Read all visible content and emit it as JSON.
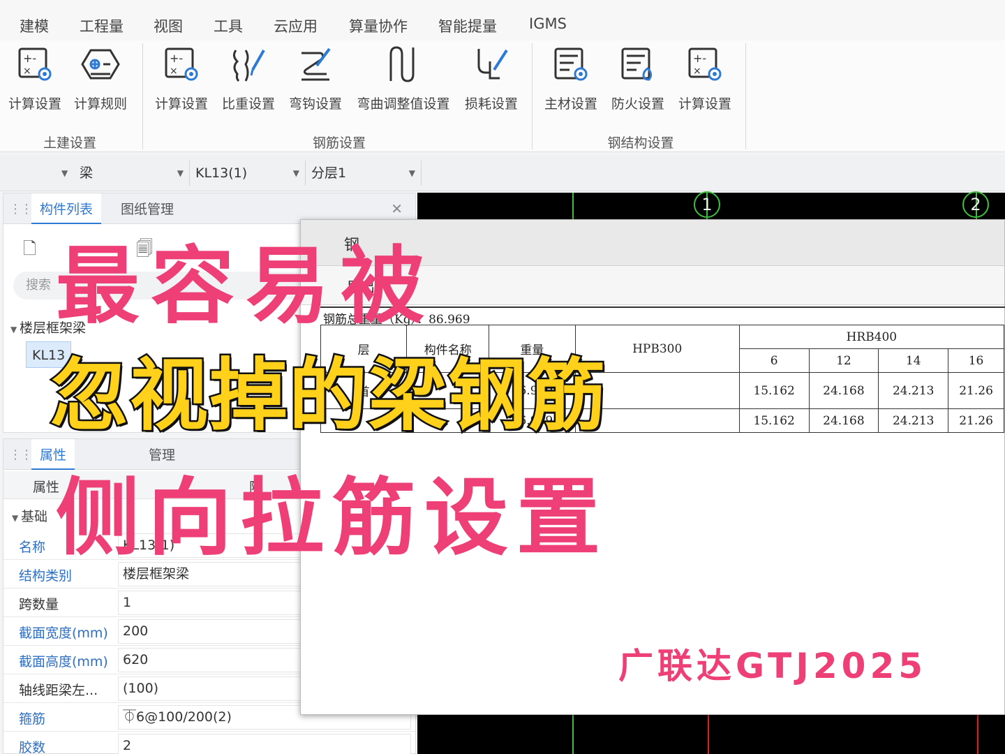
{
  "menu": [
    "建模",
    "工程量",
    "视图",
    "工具",
    "云应用",
    "算量协作",
    "智能提量",
    "IGMS"
  ],
  "ribbon": {
    "groups": [
      {
        "label": "土建设置",
        "buttons": [
          "计算设置",
          "计算规则"
        ]
      },
      {
        "label": "钢筋设置",
        "buttons": [
          "计算设置",
          "比重设置",
          "弯钩设置",
          "弯曲调整值设置",
          "损耗设置"
        ]
      },
      {
        "label": "钢结构设置",
        "buttons": [
          "主材设置",
          "防火设置",
          "计算设置"
        ]
      }
    ]
  },
  "selectors": {
    "category": "梁",
    "component": "KL13(1)",
    "layer": "分层1"
  },
  "component_panel": {
    "tabs": [
      "构件列表",
      "图纸管理"
    ],
    "search_placeholder": "搜索",
    "tree_root": "楼层框架梁",
    "tree_child": "KL13"
  },
  "property_panel": {
    "tabs": [
      "属性",
      "管理"
    ],
    "header": [
      "属性",
      "附"
    ],
    "group": "基础",
    "rows": [
      {
        "name": "名称",
        "value": "KL13(1)"
      },
      {
        "name": "结构类别",
        "value": "楼层框架梁"
      },
      {
        "name": "跨数量",
        "value": "1"
      },
      {
        "name": "截面宽度(mm)",
        "value": "200"
      },
      {
        "name": "截面高度(mm)",
        "value": "620"
      },
      {
        "name": "轴线距梁左...",
        "value": "(100)"
      },
      {
        "name": "箍筋",
        "value": "⏁6@100/200(2)"
      },
      {
        "name": "胶数",
        "value": "2"
      }
    ]
  },
  "canvas": {
    "axes": [
      "1",
      "2"
    ]
  },
  "report": {
    "title": "钢",
    "tool_button": "导出",
    "total_weight": "钢筋总重量（Kg）：86.969",
    "header_row1": [
      "层",
      "构件名称",
      "重量",
      "HPB300",
      "HRB400"
    ],
    "header_row2": [
      "6",
      "12",
      "14",
      "16"
    ],
    "rows": [
      {
        "floor": "首",
        "name": "",
        "weight": "86.969",
        "hpb": "",
        "c6": "15.162",
        "c12": "24.168",
        "c14": "24.213",
        "c16": "21.26"
      },
      {
        "floor": "",
        "name": "",
        "weight": "86.969",
        "hpb": "",
        "c6": "15.162",
        "c12": "24.168",
        "c14": "24.213",
        "c16": "21.26"
      }
    ]
  },
  "overlay": {
    "line1": "最容易被",
    "line2": "忽视掉的梁钢筋",
    "line3": "侧向拉筋设置",
    "brand": "广联达GTJ2025"
  },
  "colors": {
    "overlay_pink": "#ee3f77",
    "overlay_yellow": "#ffd11a",
    "accent_blue": "#2d7ad6",
    "axis_green": "#3fbf3f"
  }
}
